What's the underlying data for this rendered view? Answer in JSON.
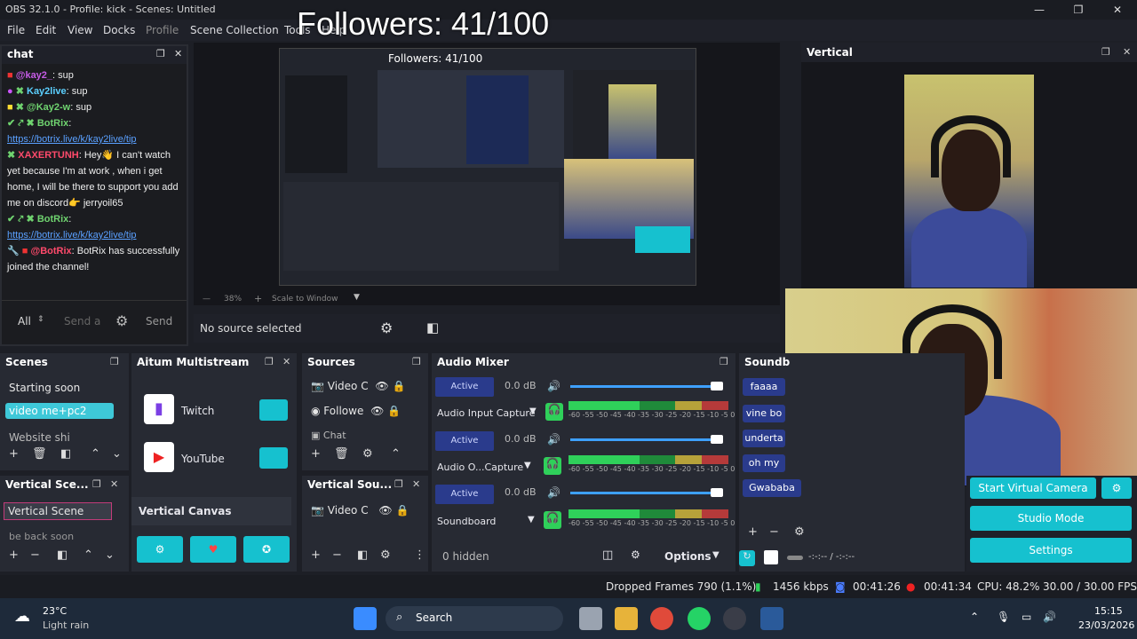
{
  "window": {
    "title": "OBS 32.1.0 - Profile: kick - Scenes: Untitled",
    "controls": [
      "—",
      "❐",
      "✕"
    ]
  },
  "menu": [
    "File",
    "Edit",
    "View",
    "Docks",
    "Profile",
    "Scene Collection",
    "Tools",
    "Help"
  ],
  "overlay": {
    "followers": "Followers: 41/100"
  },
  "chat": {
    "title": "chat",
    "messages": [
      {
        "user": "@kay2_",
        "text": ": sup"
      },
      {
        "user": "Kay2live",
        "text": ": sup"
      },
      {
        "user": "@Kay2-w",
        "text": ": sup"
      },
      {
        "user": "BotRix",
        "text": ":"
      },
      {
        "link": "https://botrix.live/k/kay2live/tip"
      },
      {
        "user": "XAXERTUNH",
        "text": ": Hey👋 I can't watch yet because I'm at work , when i get home, I will be there to support you add me on discord👉 jerryoil65"
      },
      {
        "user": "BotRix",
        "text": ":"
      },
      {
        "link": "https://botrix.live/k/kay2live/tip"
      },
      {
        "user": "@BotRix",
        "text": ": BotRix has successfully joined the channel!"
      }
    ],
    "filter": "All",
    "placeholder": "Send a",
    "send": "Send"
  },
  "preview": {
    "no_source": "No source selected",
    "zoom": "38%",
    "scale": "Scale to Window",
    "inner_followers": "Followers: 41/100"
  },
  "vertical": {
    "title": "Vertical"
  },
  "scenes": {
    "title": "Scenes",
    "items": [
      "Starting soon",
      "video me+pc2",
      "Website shi"
    ]
  },
  "vertical_scenes": {
    "title": "Vertical Sce...",
    "items": [
      "Vertical Scene",
      "be back soon"
    ]
  },
  "multistream": {
    "title": "Aitum Multistream",
    "targets": [
      "Twitch",
      "YouTube"
    ],
    "canvas": "Vertical Canvas"
  },
  "sources": {
    "title": "Sources",
    "items": [
      "Video C",
      "Followe",
      "Chat"
    ]
  },
  "vertical_sources": {
    "title": "Vertical Sou...",
    "items": [
      "Video C"
    ]
  },
  "mixer": {
    "title": "Audio Mixer",
    "channels": [
      {
        "name": "Audio Input Capture",
        "db": "0.0 dB",
        "state": "Active"
      },
      {
        "name": "Audio O...Capture",
        "db": "0.0 dB",
        "state": "Active"
      },
      {
        "name": "Soundboard",
        "db": "0.0 dB",
        "state": "Active"
      }
    ],
    "ticks": "-60 -55 -50 -45 -40 -35 -30 -25 -20 -15 -10 -5 0",
    "hidden": "0 hidden",
    "options": "Options"
  },
  "soundboard": {
    "title": "Soundb",
    "items": [
      "faaaa",
      "vine bo",
      "underta",
      "oh my",
      "Gwababa"
    ],
    "time": "-:-:-- / -:-:--"
  },
  "controls": {
    "virtual_camera": "Start Virtual Camera",
    "studio_mode": "Studio Mode",
    "settings": "Settings"
  },
  "status": {
    "dropped": "Dropped Frames 790 (1.1%)",
    "bitrate": "1456 kbps",
    "stream_time": "00:41:26",
    "rec_time": "00:41:34",
    "cpu": "CPU: 48.2%",
    "fps": "30.00 / 30.00 FPS"
  },
  "taskbar": {
    "temp": "23°C",
    "weather": "Light rain",
    "search": "Search",
    "time": "15:15",
    "date": "23/03/2026"
  },
  "colors": {
    "accent": "#16c1cf",
    "meter_green": "#2fd05a",
    "meter_red": "#b53a3a"
  }
}
